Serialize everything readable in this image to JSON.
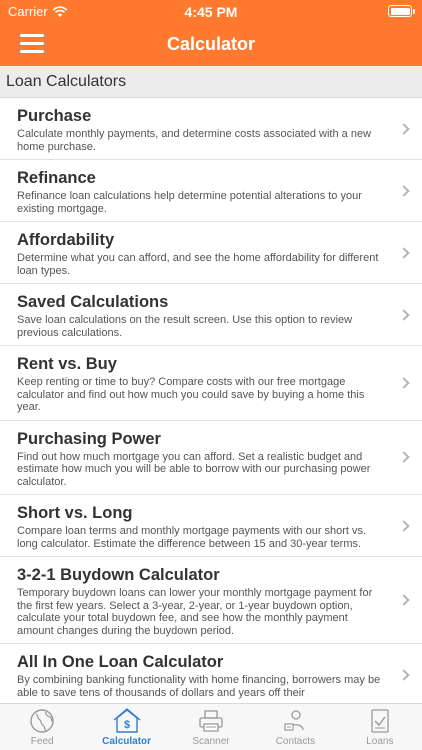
{
  "status": {
    "carrier": "Carrier",
    "time": "4:45 PM"
  },
  "nav": {
    "title": "Calculator",
    "menu_icon": "hamburger-menu-icon"
  },
  "section": {
    "title": "Loan Calculators"
  },
  "items": [
    {
      "title": "Purchase",
      "desc": "Calculate monthly payments, and determine costs associated with a new home purchase."
    },
    {
      "title": "Refinance",
      "desc": "Refinance loan calculations help determine potential alterations to your existing mortgage."
    },
    {
      "title": "Affordability",
      "desc": "Determine what you can afford, and see the home affordability for different loan types."
    },
    {
      "title": "Saved Calculations",
      "desc": "Save loan calculations on the result screen. Use this option to review previous calculations."
    },
    {
      "title": "Rent vs. Buy",
      "desc": "Keep renting or time to buy? Compare costs with our free mortgage calculator and find out how much you could save by buying a home this year."
    },
    {
      "title": "Purchasing Power",
      "desc": "Find out how much mortgage you can afford. Set a realistic budget and estimate how much you will be able to borrow with our purchasing power calculator."
    },
    {
      "title": "Short vs. Long",
      "desc": "Compare loan terms and monthly mortgage payments with our short vs. long calculator. Estimate the difference between 15 and 30-year terms."
    },
    {
      "title": "3-2-1 Buydown Calculator",
      "desc": "Temporary buydown loans can lower your monthly mortgage payment for the first few years. Select a 3-year, 2-year, or 1-year buydown option, calculate your total buydown fee, and see how the monthly payment amount changes during the buydown period."
    },
    {
      "title": "All In One Loan Calculator",
      "desc": "By combining banking functionality with home financing, borrowers may be able to save tens of thousands of dollars and years off their"
    }
  ],
  "tabs": [
    {
      "label": "Feed",
      "icon": "globe-icon",
      "active": false
    },
    {
      "label": "Calculator",
      "icon": "calculator-dollar-icon",
      "active": true
    },
    {
      "label": "Scanner",
      "icon": "scanner-icon",
      "active": false
    },
    {
      "label": "Contacts",
      "icon": "contacts-icon",
      "active": false
    },
    {
      "label": "Loans",
      "icon": "loans-document-icon",
      "active": false
    }
  ],
  "colors": {
    "brand": "#ff7a2f",
    "active_tab": "#2e7fd0",
    "inactive_tab": "#9a9a9a"
  }
}
